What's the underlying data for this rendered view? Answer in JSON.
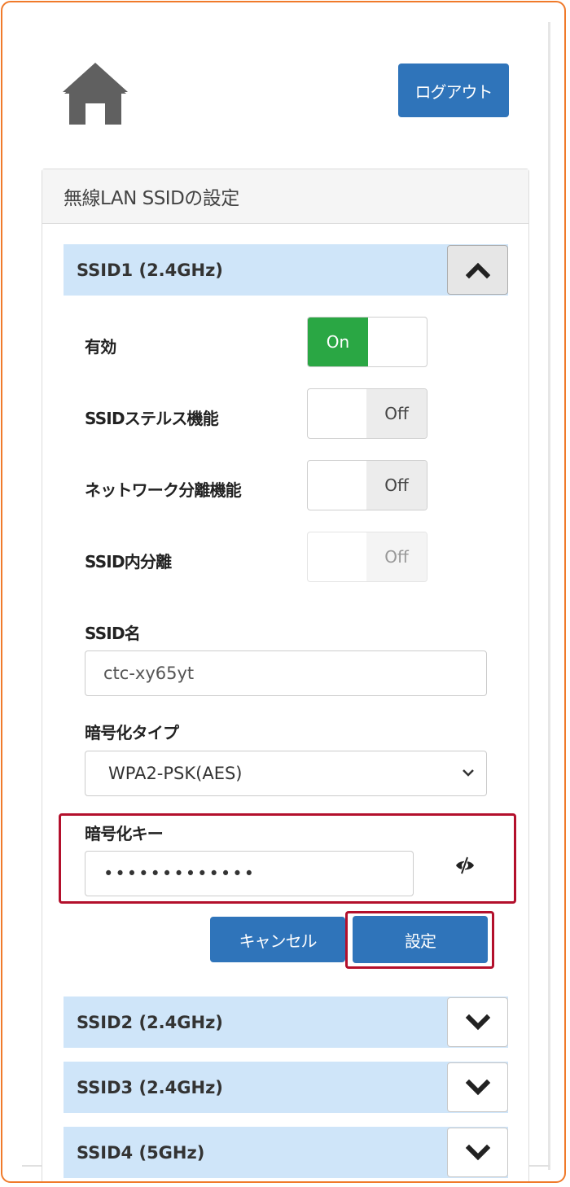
{
  "header": {
    "home_icon": "home-icon",
    "logout_label": "ログアウト"
  },
  "panel": {
    "title": "無線LAN SSIDの設定"
  },
  "ssid1": {
    "label": "SSID1 (2.4GHz)",
    "expanded": true,
    "toggle_icon": "chevron-up-icon",
    "settings": [
      {
        "label": "有効",
        "state": "On",
        "on": true,
        "disabled": false
      },
      {
        "label": "SSIDステルス機能",
        "state": "Off",
        "on": false,
        "disabled": false
      },
      {
        "label": "ネットワーク分離機能",
        "state": "Off",
        "on": false,
        "disabled": false
      },
      {
        "label": "SSID内分離",
        "state": "Off",
        "on": false,
        "disabled": true
      }
    ],
    "ssid_name_label": "SSID名",
    "ssid_name_value": "ctc-xy65yt",
    "encryption_type_label": "暗号化タイプ",
    "encryption_type_value": "WPA2-PSK(AES)",
    "encryption_key_label": "暗号化キー",
    "encryption_key_value": "•••••••••••••",
    "visibility_icon": "eye-slash-icon",
    "cancel_label": "キャンセル",
    "save_label": "設定"
  },
  "other_ssids": [
    {
      "label": "SSID2 (2.4GHz)",
      "expanded": false,
      "toggle_icon": "chevron-down-icon"
    },
    {
      "label": "SSID3 (2.4GHz)",
      "expanded": false,
      "toggle_icon": "chevron-down-icon"
    },
    {
      "label": "SSID4 (5GHz)",
      "expanded": false,
      "toggle_icon": "chevron-down-icon"
    }
  ],
  "colors": {
    "accent_blue": "#2f74ba",
    "switch_on": "#2aa744",
    "ssid_bar": "#cfe5f9",
    "highlight": "#b3102c",
    "frame": "#f07a2a"
  }
}
